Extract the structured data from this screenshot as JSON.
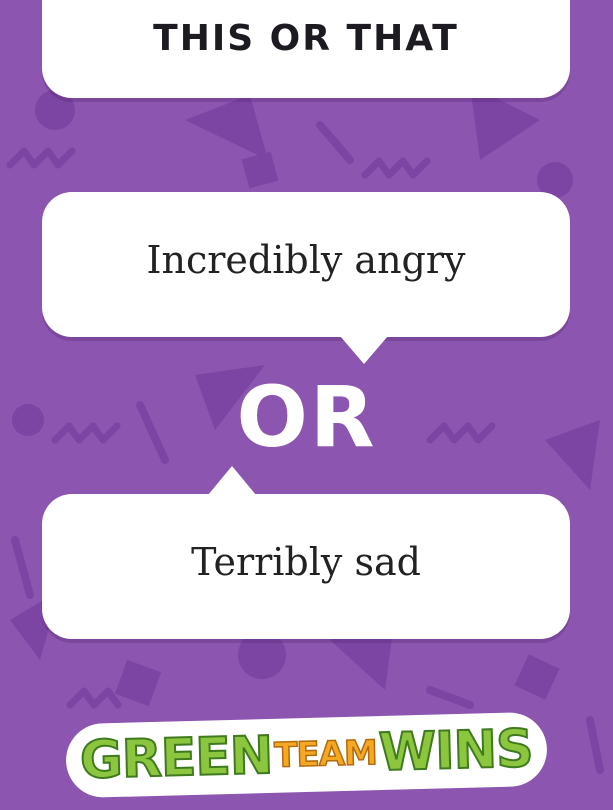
{
  "colors": {
    "background": "#8b55b0",
    "pattern": "#7c45a3",
    "card": "#ffffff",
    "title_text": "#1e1a22",
    "or_text": "#ffffff",
    "logo_green": "#8cc63f",
    "logo_orange": "#f7a823"
  },
  "header": {
    "title": "THIS OR THAT"
  },
  "options": {
    "first": "Incredibly angry",
    "separator": "OR",
    "second": "Terribly sad"
  },
  "logo": {
    "word1": "GREEN",
    "word2": "TEAM",
    "word3": "WINS"
  }
}
